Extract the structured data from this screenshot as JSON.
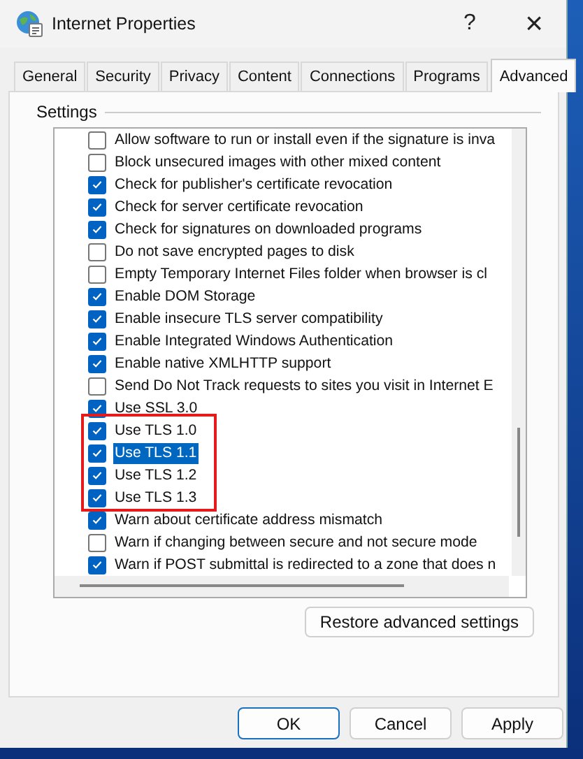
{
  "window": {
    "title": "Internet Properties",
    "help": "?",
    "close": "×"
  },
  "tabs": [
    {
      "label": "General",
      "selected": false
    },
    {
      "label": "Security",
      "selected": false
    },
    {
      "label": "Privacy",
      "selected": false
    },
    {
      "label": "Content",
      "selected": false
    },
    {
      "label": "Connections",
      "selected": false
    },
    {
      "label": "Programs",
      "selected": false
    },
    {
      "label": "Advanced",
      "selected": true
    }
  ],
  "settings": {
    "label": "Settings",
    "items": [
      {
        "label": "Allow software to run or install even if the signature is inva",
        "checked": false,
        "selected": false,
        "highlighted": false
      },
      {
        "label": "Block unsecured images with other mixed content",
        "checked": false,
        "selected": false,
        "highlighted": false
      },
      {
        "label": "Check for publisher's certificate revocation",
        "checked": true,
        "selected": false,
        "highlighted": false
      },
      {
        "label": "Check for server certificate revocation",
        "checked": true,
        "selected": false,
        "highlighted": false
      },
      {
        "label": "Check for signatures on downloaded programs",
        "checked": true,
        "selected": false,
        "highlighted": false
      },
      {
        "label": "Do not save encrypted pages to disk",
        "checked": false,
        "selected": false,
        "highlighted": false
      },
      {
        "label": "Empty Temporary Internet Files folder when browser is cl",
        "checked": false,
        "selected": false,
        "highlighted": false
      },
      {
        "label": "Enable DOM Storage",
        "checked": true,
        "selected": false,
        "highlighted": false
      },
      {
        "label": "Enable insecure TLS server compatibility",
        "checked": true,
        "selected": false,
        "highlighted": false
      },
      {
        "label": "Enable Integrated Windows Authentication",
        "checked": true,
        "selected": false,
        "highlighted": false
      },
      {
        "label": "Enable native XMLHTTP support",
        "checked": true,
        "selected": false,
        "highlighted": false
      },
      {
        "label": "Send Do Not Track requests to sites you visit in Internet E",
        "checked": false,
        "selected": false,
        "highlighted": false
      },
      {
        "label": "Use SSL 3.0",
        "checked": true,
        "selected": false,
        "highlighted": false
      },
      {
        "label": "Use TLS 1.0",
        "checked": true,
        "selected": false,
        "highlighted": true
      },
      {
        "label": "Use TLS 1.1",
        "checked": true,
        "selected": true,
        "highlighted": true
      },
      {
        "label": "Use TLS 1.2",
        "checked": true,
        "selected": false,
        "highlighted": true
      },
      {
        "label": "Use TLS 1.3",
        "checked": true,
        "selected": false,
        "highlighted": true
      },
      {
        "label": "Warn about certificate address mismatch",
        "checked": true,
        "selected": false,
        "highlighted": false
      },
      {
        "label": "Warn if changing between secure and not secure mode",
        "checked": false,
        "selected": false,
        "highlighted": false
      },
      {
        "label": "Warn if POST submittal is redirected to a zone that does n",
        "checked": true,
        "selected": false,
        "highlighted": false
      }
    ]
  },
  "restore_button": "Restore advanced settings",
  "buttons": [
    {
      "label": "OK",
      "default": true
    },
    {
      "label": "Cancel",
      "default": false
    },
    {
      "label": "Apply",
      "default": false
    }
  ]
}
